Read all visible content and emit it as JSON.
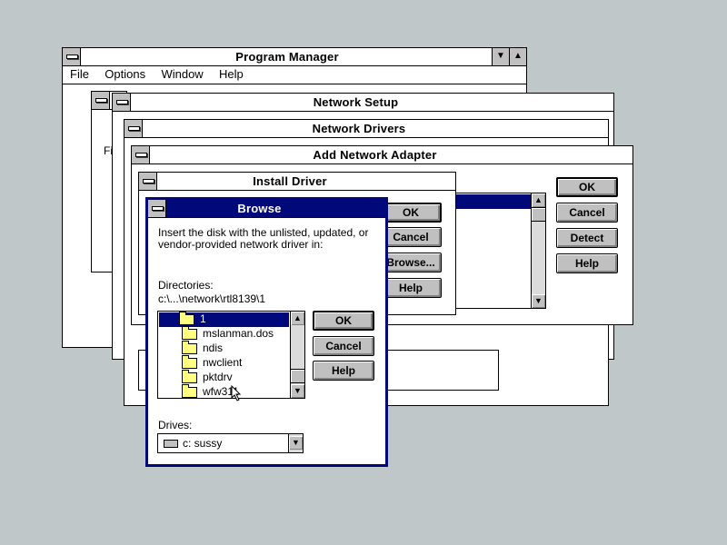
{
  "program_manager": {
    "title": "Program Manager",
    "menu": [
      "File",
      "Options",
      "Window",
      "Help"
    ]
  },
  "background_window": {
    "label_fragment": "Fi"
  },
  "network_setup": {
    "title": "Network Setup"
  },
  "network_drivers": {
    "title": "Network Drivers"
  },
  "add_network_adapter": {
    "title": "Add Network Adapter",
    "buttons": [
      "OK",
      "Cancel",
      "Detect",
      "Help"
    ]
  },
  "install_driver": {
    "title": "Install Driver",
    "buttons": [
      "OK",
      "Cancel",
      "Browse...",
      "Help"
    ]
  },
  "browse": {
    "title": "Browse",
    "instruction": "Insert the disk with the unlisted, updated, or vendor-provided network driver in:",
    "directories_label": "Directories:",
    "current_path": "c:\\...\\network\\rtl8139\\1",
    "folders": [
      "1",
      "mslanman.dos",
      "ndis",
      "nwclient",
      "pktdrv",
      "wfw311"
    ],
    "selected_folder": "1",
    "drives_label": "Drives:",
    "drive_value": "c: sussy",
    "buttons": [
      "OK",
      "Cancel",
      "Help"
    ]
  },
  "colors": {
    "desktop": "#c0c7c8",
    "active_title": "#00087a",
    "button_face": "#c0c0c0"
  }
}
